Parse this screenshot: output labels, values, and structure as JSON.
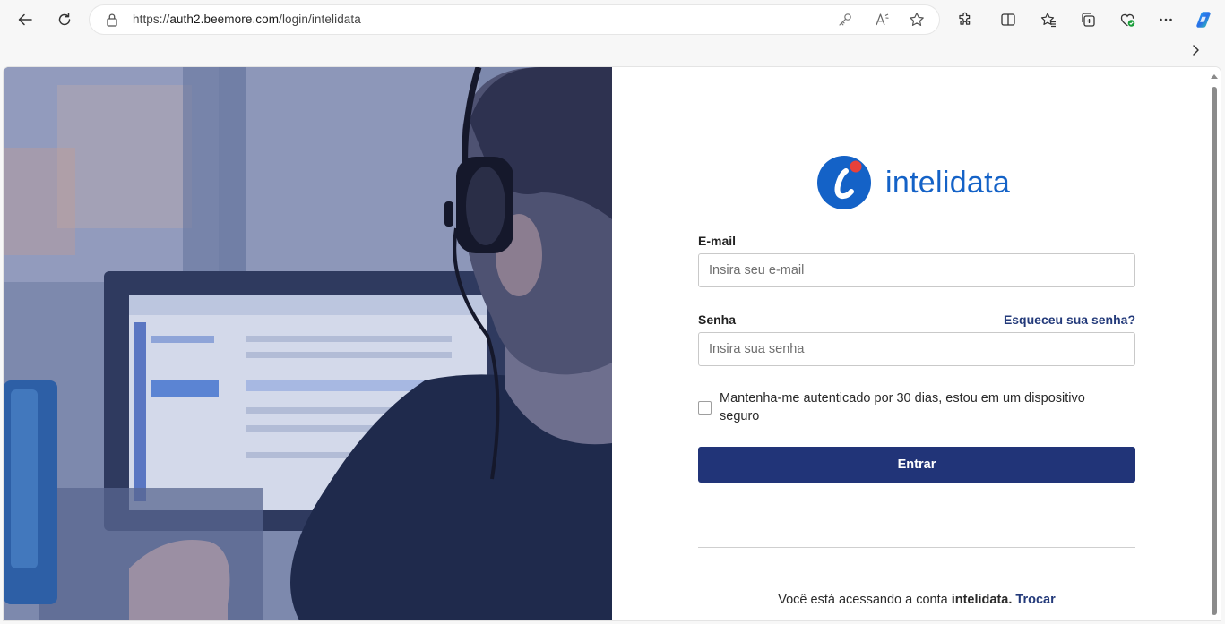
{
  "browser": {
    "url_prefix": "https://",
    "url_host": "auth2.beemore.com",
    "url_path": "/login/intelidata"
  },
  "brand": {
    "name": "intelidata",
    "color": "#1462c7",
    "accent": "#e8413a"
  },
  "form": {
    "email_label": "E-mail",
    "email_placeholder": "Insira seu e-mail",
    "password_label": "Senha",
    "forgot_link": "Esqueceu sua senha?",
    "password_placeholder": "Insira sua senha",
    "remember_text": "Mantenha-me autenticado por 30 dias, estou em um dispositivo seguro",
    "submit_label": "Entrar",
    "button_color": "#213478"
  },
  "account": {
    "prefix": "Você está acessando a conta",
    "org": "intelidata.",
    "switch_link": "Trocar"
  },
  "icons": [
    "back-icon",
    "refresh-icon",
    "lock-icon",
    "key-icon",
    "read-aloud-icon",
    "favorite-star-icon",
    "extensions-icon",
    "split-screen-icon",
    "favorites-icon",
    "collections-icon",
    "browser-essentials-icon",
    "more-icon",
    "copilot-icon",
    "chevron-right-icon"
  ]
}
